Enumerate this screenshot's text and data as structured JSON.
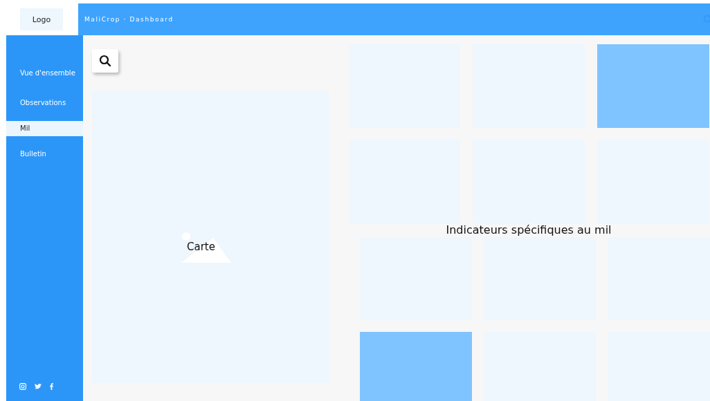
{
  "logo": "Logo",
  "header": {
    "title": "MaliCrop · Dashboard"
  },
  "sidebar": {
    "items": [
      {
        "label": "Vue d'ensemble",
        "selected": false
      },
      {
        "label": "Observations",
        "selected": false
      },
      {
        "label": "Mil",
        "selected": true
      },
      {
        "label": "Bulletin",
        "selected": false
      }
    ]
  },
  "map": {
    "label": "Carte"
  },
  "top_tiles": [
    {
      "highlighted": false
    },
    {
      "highlighted": false
    },
    {
      "highlighted": true
    },
    {
      "highlighted": false
    },
    {
      "highlighted": false
    },
    {
      "highlighted": false
    }
  ],
  "section_title": "Indicateurs spécifiques au mil",
  "bottom_tiles": [
    {
      "highlighted": false
    },
    {
      "highlighted": false
    },
    {
      "highlighted": false
    },
    {
      "highlighted": true
    },
    {
      "highlighted": false
    },
    {
      "highlighted": false
    }
  ]
}
